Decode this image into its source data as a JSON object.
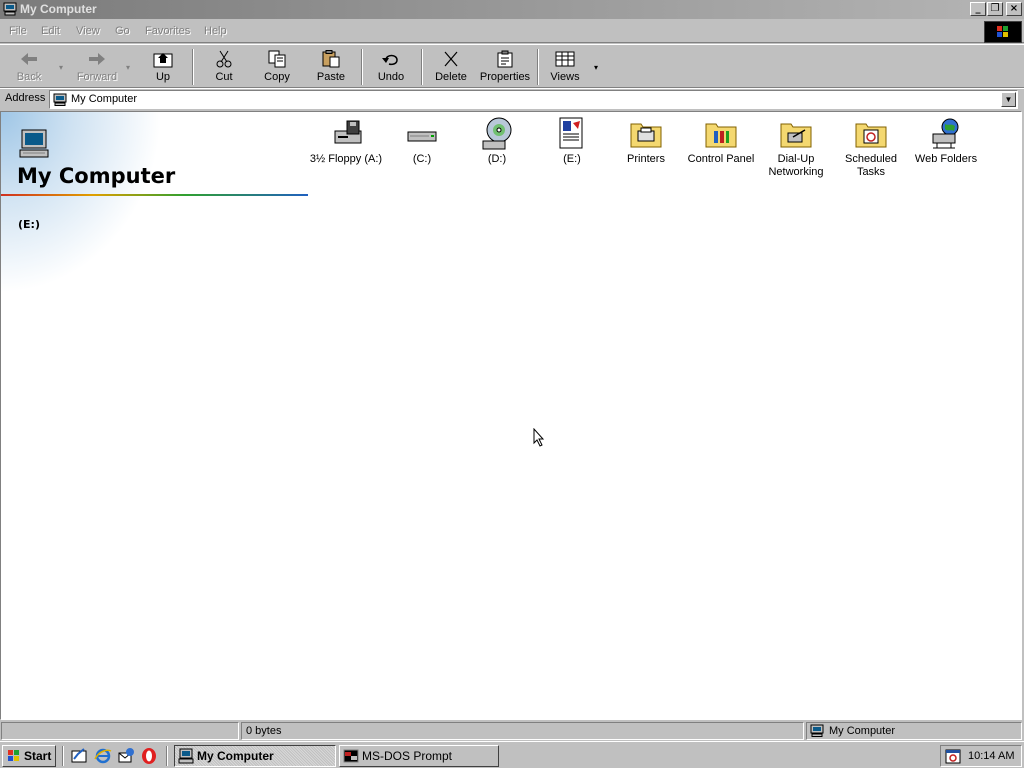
{
  "window": {
    "title": "My Computer"
  },
  "window_buttons": {
    "minimize": "_",
    "maximize": "❐",
    "close": "×"
  },
  "menu": [
    {
      "label": "File"
    },
    {
      "label": "Edit"
    },
    {
      "label": "View"
    },
    {
      "label": "Go"
    },
    {
      "label": "Favorites"
    },
    {
      "label": "Help"
    }
  ],
  "toolbar": {
    "back": "Back",
    "forward": "Forward",
    "up": "Up",
    "cut": "Cut",
    "copy": "Copy",
    "paste": "Paste",
    "undo": "Undo",
    "delete": "Delete",
    "properties": "Properties",
    "views": "Views"
  },
  "address": {
    "label": "Address",
    "value": "My Computer"
  },
  "webview": {
    "title": "My Computer",
    "selected_item": "(E:)"
  },
  "items": [
    {
      "label": "3½ Floppy (A:)",
      "icon": "floppy-drive-icon"
    },
    {
      "label": "(C:)",
      "icon": "hard-drive-icon"
    },
    {
      "label": "(D:)",
      "icon": "cd-drive-icon"
    },
    {
      "label": "(E:)",
      "icon": "document-drive-icon"
    },
    {
      "label": "Printers",
      "icon": "printers-folder-icon"
    },
    {
      "label": "Control Panel",
      "icon": "control-panel-folder-icon"
    },
    {
      "label": "Dial-Up Networking",
      "icon": "dialup-folder-icon"
    },
    {
      "label": "Scheduled Tasks",
      "icon": "scheduled-tasks-folder-icon"
    },
    {
      "label": "Web Folders",
      "icon": "web-folders-icon"
    }
  ],
  "status": {
    "size": "0 bytes",
    "zone": "My Computer"
  },
  "taskbar": {
    "start": "Start",
    "tasks": [
      {
        "label": "My Computer",
        "active": true
      },
      {
        "label": "MS-DOS Prompt",
        "active": false
      }
    ],
    "clock": "10:14 AM"
  }
}
